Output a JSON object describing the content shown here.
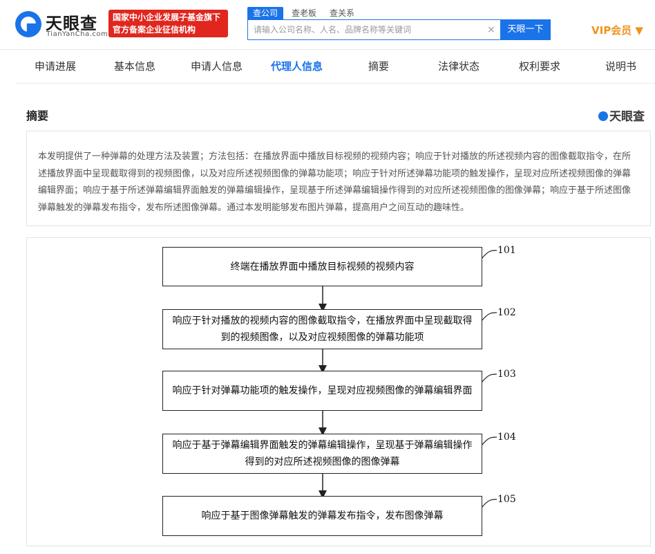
{
  "header": {
    "logo_cn": "天眼查",
    "logo_en": "TianYanCha.com",
    "badge_line1": "国家中小企业发展子基金旗下",
    "badge_line2": "官方备案企业征信机构",
    "search_tabs": [
      "查公司",
      "查老板",
      "查关系"
    ],
    "search_placeholder": "请输入公司名称、人名、品牌名称等关键词",
    "search_button": "天眼一下",
    "vip_label": "VIP会员 ▼"
  },
  "nav": {
    "tabs": [
      "申请进展",
      "基本信息",
      "申请人信息",
      "代理人信息",
      "摘要",
      "法律状态",
      "权利要求",
      "说明书"
    ],
    "active_index": 3
  },
  "section": {
    "title": "摘要",
    "watermark": "天眼查"
  },
  "abstract": {
    "text": "本发明提供了一种弹幕的处理方法及装置；方法包括：在播放界面中播放目标视频的视频内容；响应于针对播放的所述视频内容的图像截取指令，在所述播放界面中呈现截取得到的视频图像，以及对应所述视频图像的弹幕功能项；响应于针对所述弹幕功能项的触发操作，呈现对应所述视频图像的弹幕编辑界面；响应于基于所述弹幕编辑界面触发的弹幕编辑操作，呈现基于所述弹幕编辑操作得到的对应所述视频图像的图像弹幕；响应于基于所述图像弹幕触发的弹幕发布指令，发布所述图像弹幕。通过本发明能够发布图片弹幕，提高用户之间互动的趣味性。"
  },
  "flowchart": {
    "steps": [
      {
        "number": "101",
        "text": "终端在播放界面中播放目标视频的视频内容"
      },
      {
        "number": "102",
        "text": "响应于针对播放的视频内容的图像截取指令，在播放界面中呈现截取得到的视频图像，以及对应视频图像的弹幕功能项"
      },
      {
        "number": "103",
        "text": "响应于针对弹幕功能项的触发操作，呈现对应视频图像的弹幕编辑界面"
      },
      {
        "number": "104",
        "text": "响应于基于弹幕编辑界面触发的弹幕编辑操作，呈现基于弹幕编辑操作得到的对应所述视频图像的图像弹幕"
      },
      {
        "number": "105",
        "text": "响应于基于图像弹幕触发的弹幕发布指令，发布图像弹幕"
      }
    ]
  }
}
